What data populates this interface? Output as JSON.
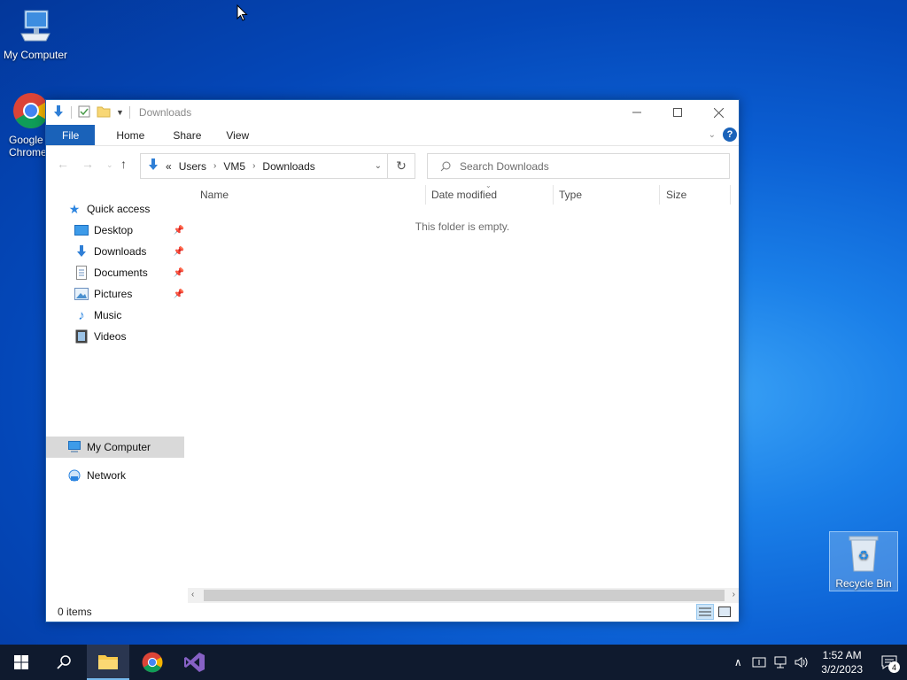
{
  "desktop": {
    "icons": {
      "my_computer": "My Computer",
      "chrome": "Google Chrome",
      "recycle_bin": "Recycle Bin"
    }
  },
  "window": {
    "title": "Downloads",
    "ribbon_tabs": [
      "File",
      "Home",
      "Share",
      "View"
    ],
    "help": "?",
    "address": {
      "overflow": "«",
      "crumbs": [
        "Users",
        "VM5",
        "Downloads"
      ]
    },
    "search_placeholder": "Search Downloads",
    "nav": {
      "quick_access": "Quick access",
      "items": [
        "Desktop",
        "Downloads",
        "Documents",
        "Pictures",
        "Music",
        "Videos"
      ],
      "my_computer": "My Computer",
      "network": "Network"
    },
    "columns": [
      "Name",
      "Date modified",
      "Type",
      "Size"
    ],
    "empty_message": "This folder is empty.",
    "status": "0 items"
  },
  "taskbar": {
    "time": "1:52 AM",
    "date": "3/2/2023",
    "notification_count": "4"
  },
  "colors": {
    "accent": "#1a62b9",
    "taskbar": "#0f1a2e"
  }
}
